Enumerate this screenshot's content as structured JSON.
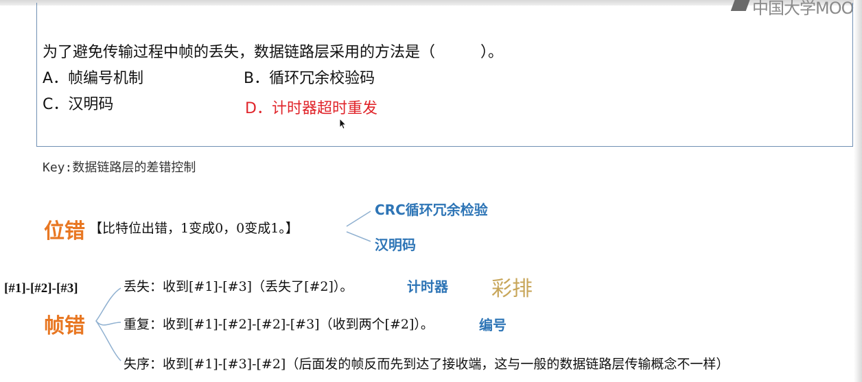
{
  "watermark": "中国大学MOOC",
  "question": {
    "stem": "为了避免传输过程中帧的丢失，数据链路层采用的方法是（　　　）。",
    "options": [
      {
        "label": "A．帧编号机制",
        "correct": false
      },
      {
        "label": "B．循环冗余校验码",
        "correct": false
      },
      {
        "label": "C．汉明码",
        "correct": false
      },
      {
        "label": "D．计时器超时重发",
        "correct": true
      }
    ]
  },
  "key": "Key:数据链路层的差错控制",
  "bit_error": {
    "title": "位错",
    "desc": "【比特位出错，1变成0，0变成1。】",
    "branches": [
      "CRC循环冗余检验",
      "汉明码"
    ]
  },
  "frame_error": {
    "sequence_label": "[#1]-[#2]-[#3]",
    "title": "帧错",
    "rehearsal": "彩排",
    "items": [
      {
        "text": "丢失：收到[#1]-[#3]（丢失了[#2]）。",
        "solution": "计时器"
      },
      {
        "text": "重复：收到[#1]-[#2]-[#2]-[#3]（收到两个[#2]）。",
        "solution": "编号"
      },
      {
        "text": "失序：收到[#1]-[#3]-[#2]（后面发的帧反而先到达了接收端，这与一般的数据链路层传输概念不一样）",
        "solution": ""
      }
    ]
  },
  "colors": {
    "correct_answer": "#e0242a",
    "heading_orange": "#e87722",
    "solution_blue": "#2e75b6",
    "rehearsal_gold": "#c8a65a",
    "box_border": "#6f8fb3"
  }
}
